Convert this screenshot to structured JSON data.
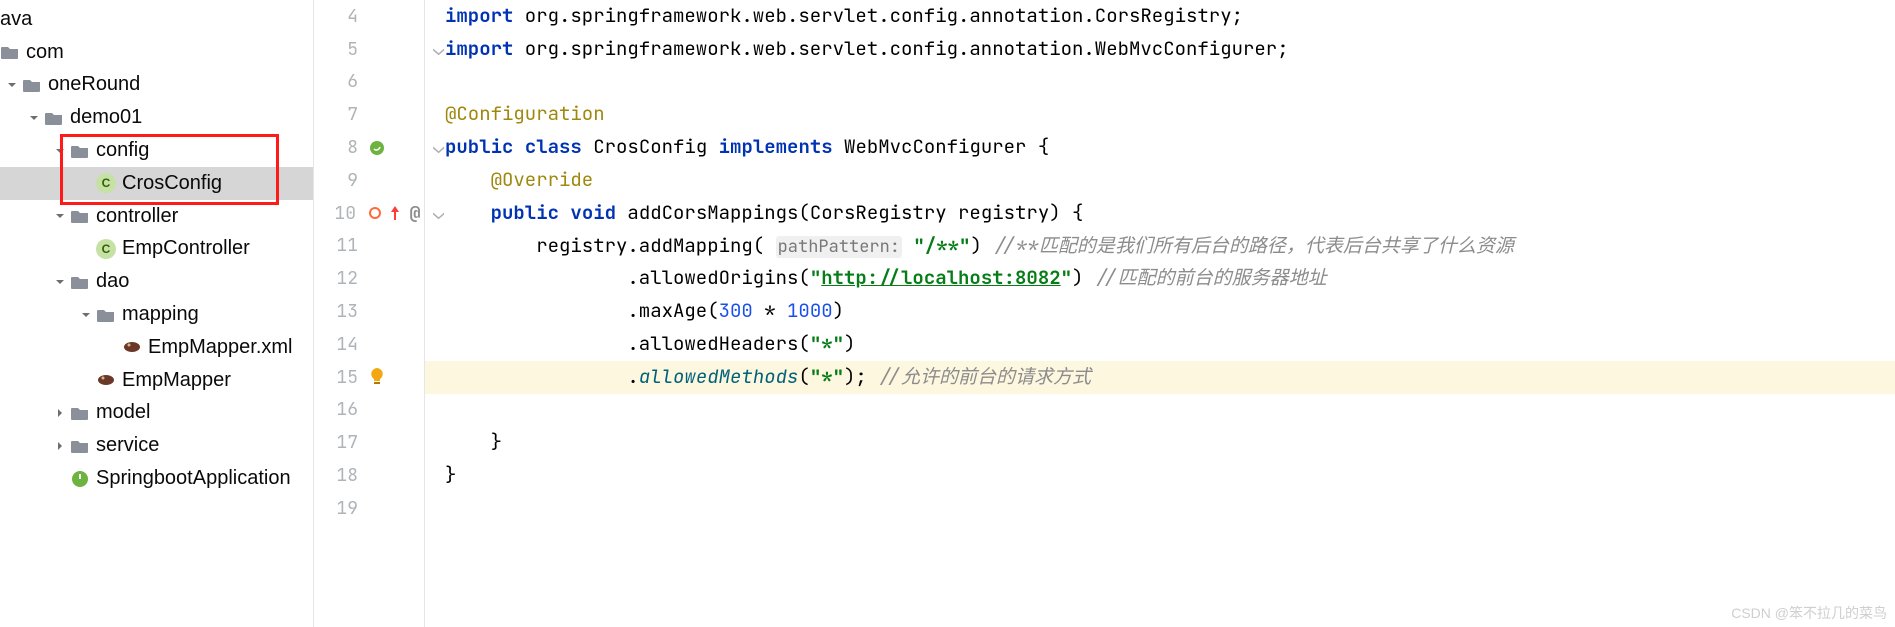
{
  "tree": {
    "l0": "ava",
    "l1": "com",
    "l2": "oneRound",
    "l3": "demo01",
    "l4": "config",
    "l5": "CrosConfig",
    "l6": "controller",
    "l7": "EmpController",
    "l8": "dao",
    "l9": "mapping",
    "l10": "EmpMapper.xml",
    "l11": "EmpMapper",
    "l12": "model",
    "l13": "service",
    "l14": "SpringbootApplication"
  },
  "gutter": {
    "lines": [
      "4",
      "5",
      "6",
      "7",
      "8",
      "9",
      "10",
      "11",
      "12",
      "13",
      "14",
      "15",
      "16",
      "17",
      "18",
      "19"
    ]
  },
  "code": {
    "l4_kw": "import",
    "l4_rest": " org.springframework.web.servlet.config.annotation.CorsRegistry;",
    "l5_kw": "import",
    "l5_rest": " org.springframework.web.servlet.config.annotation.WebMvcConfigurer;",
    "l7_anno": "@Configuration",
    "l8_public": "public",
    "l8_class": "class",
    "l8_name": " CrosConfig ",
    "l8_impl": "implements",
    "l8_iface": " WebMvcConfigurer {",
    "l9_anno": "@Override",
    "l10_public": "public",
    "l10_void": "void",
    "l10_sig": " addCorsMappings(CorsRegistry registry) {",
    "l11_pre": "        registry.addMapping( ",
    "l11_hint": "pathPattern:",
    "l11_sp": " ",
    "l11_str": "\"/**\"",
    "l11_post": ") ",
    "l11_cmt": "//**匹配的是我们所有后台的路径，代表后台共享了什么资源",
    "l12_pre": "                .allowedOrigins(",
    "l12_q1": "\"",
    "l12_url": "http://localhost:8082",
    "l12_q2": "\"",
    "l12_post": ") ",
    "l12_cmt": "//匹配的前台的服务器地址",
    "l13_pre": "                .maxAge(",
    "l13_n1": "300",
    "l13_op": " * ",
    "l13_n2": "1000",
    "l13_post": ")",
    "l14_pre": "                .allowedHeaders(",
    "l14_str": "\"*\"",
    "l14_post": ")",
    "l15_pre": "                .",
    "l15_mtd": "allowedMethods",
    "l15_mid": "(",
    "l15_str": "\"*\"",
    "l15_post": "); ",
    "l15_cmt": "//允许的前台的请求方式",
    "l17_brace": "    }",
    "l18_brace": "}"
  },
  "watermark": "CSDN @笨不拉几的菜鸟"
}
